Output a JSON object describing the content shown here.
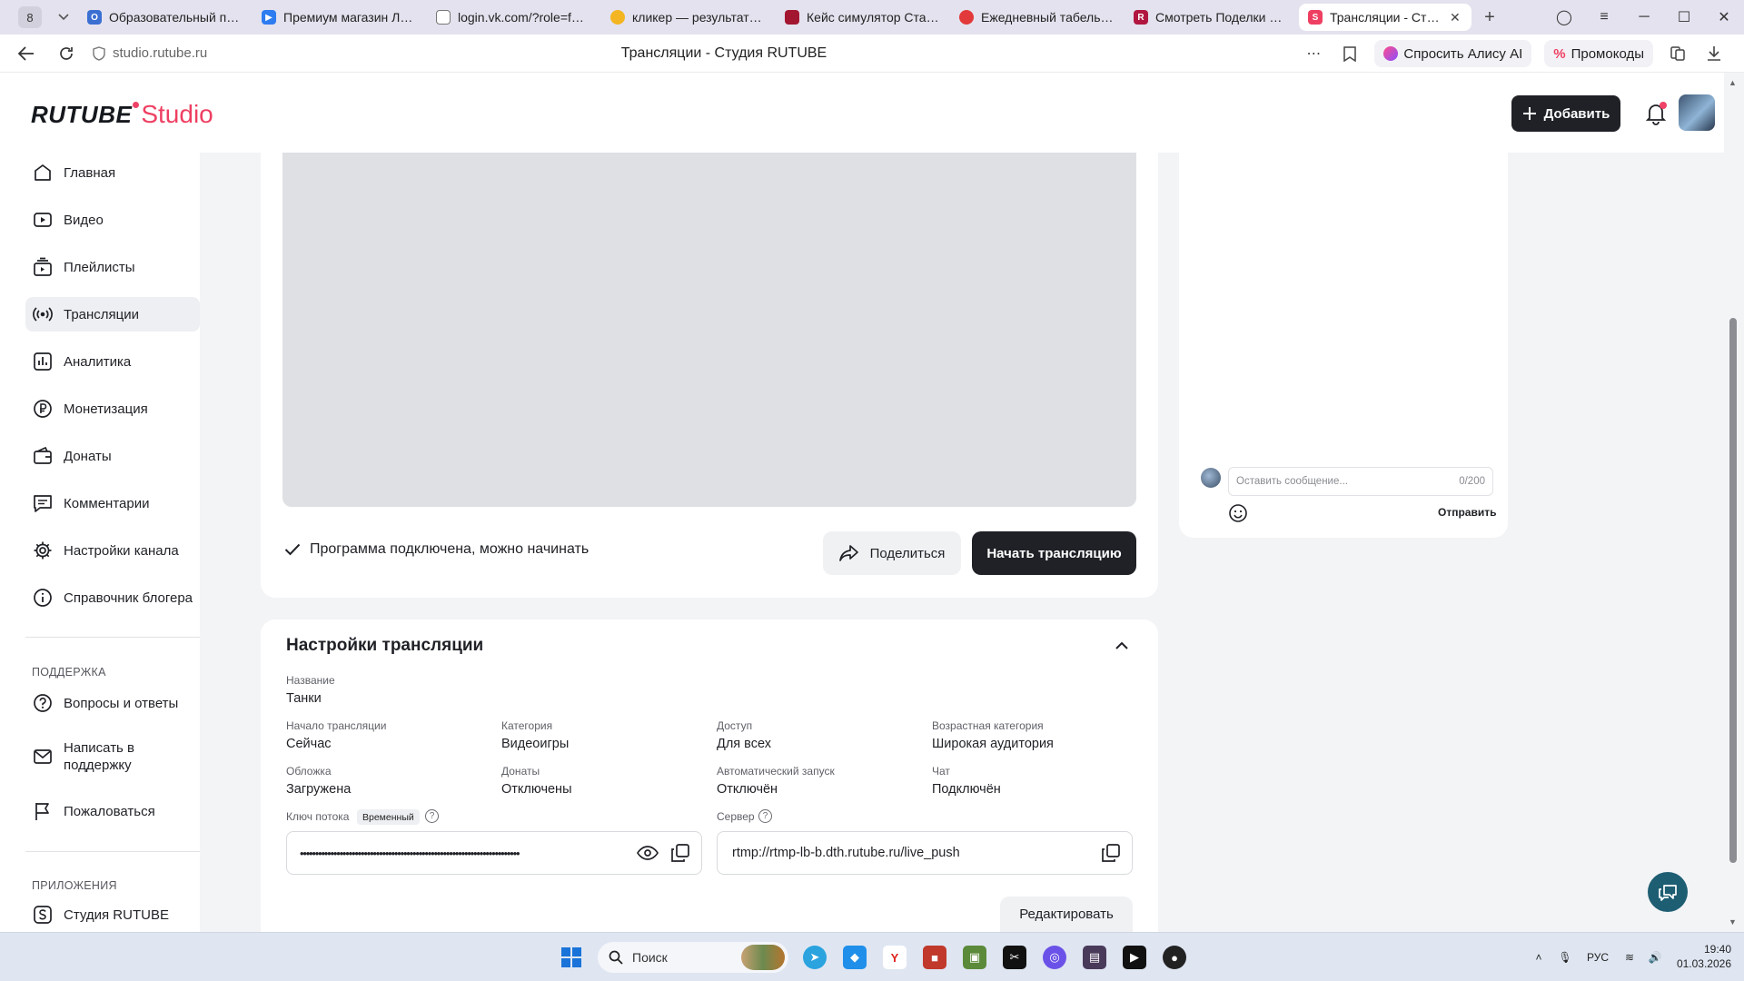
{
  "browser": {
    "tab_count": "8",
    "tabs": [
      {
        "label": "Образовательный порт",
        "color": "#3b6fd1"
      },
      {
        "label": "Премиум магазин Лест",
        "color": "#2d7cf0"
      },
      {
        "label": "login.vk.com/?role=fast&",
        "color": "#8e8e8e"
      },
      {
        "label": "кликер — результаты п",
        "color": "#f3b521"
      },
      {
        "label": "Кейс симулятор Станд",
        "color": "#a31630"
      },
      {
        "label": "Ежедневный табель-ка",
        "color": "#e23a3a"
      },
      {
        "label": "Смотреть Поделки и иг",
        "color": "#b0163f"
      },
      {
        "label": "Трансляции - Студия",
        "color": "#ee3f62"
      }
    ],
    "url": "studio.rutube.ru",
    "page_title": "Трансляции - Студия RUTUBE",
    "alice": "Спросить Алису AI",
    "promo": "Промокоды"
  },
  "header": {
    "logo_main": "RUTUBE",
    "logo_sub": "Studio",
    "add_label": "Добавить"
  },
  "sidebar": {
    "items": [
      {
        "label": "Главная"
      },
      {
        "label": "Видео"
      },
      {
        "label": "Плейлисты"
      },
      {
        "label": "Трансляции"
      },
      {
        "label": "Аналитика"
      },
      {
        "label": "Монетизация"
      },
      {
        "label": "Донаты"
      },
      {
        "label": "Комментарии"
      },
      {
        "label": "Настройки канала"
      },
      {
        "label": "Справочник блогера"
      }
    ],
    "support_heading": "ПОДДЕРЖКА",
    "support_items": [
      {
        "label": "Вопросы и ответы"
      },
      {
        "label": "Написать в поддержку"
      },
      {
        "label": "Пожаловаться"
      }
    ],
    "apps_heading": "ПРИЛОЖЕНИЯ",
    "apps_items": [
      {
        "label": "Студия RUTUBE"
      }
    ]
  },
  "stream": {
    "status_text": "Программа подключена, можно начинать",
    "share_label": "Поделиться",
    "start_label": "Начать трансляцию"
  },
  "settings": {
    "title": "Настройки трансляции",
    "name_label": "Название",
    "name_value": "Танки",
    "start_label": "Начало трансляции",
    "start_value": "Сейчас",
    "category_label": "Категория",
    "category_value": "Видеоигры",
    "access_label": "Доступ",
    "access_value": "Для всех",
    "age_label": "Возрастная категория",
    "age_value": "Широкая аудитория",
    "cover_label": "Обложка",
    "cover_value": "Загружена",
    "donates_label": "Донаты",
    "donates_value": "Отключены",
    "autostart_label": "Автоматический запуск",
    "autostart_value": "Отключён",
    "chat_label": "Чат",
    "chat_value": "Подключён",
    "key_label": "Ключ потока",
    "key_tag": "Временный",
    "key_value": "••••••••••••••••••••••••••••••••••••••••••••••••••••••••••••••••••••••••",
    "server_label": "Сервер",
    "server_value": "rtmp://rtmp-lb-b.dth.rutube.ru/live_push",
    "edit_label": "Редактировать"
  },
  "chat": {
    "placeholder": "Оставить сообщение...",
    "counter": "0/200",
    "send_label": "Отправить"
  },
  "taskbar": {
    "search_label": "Поиск",
    "lang": "РУС",
    "time": "19:40",
    "date": "01.03.2026"
  }
}
